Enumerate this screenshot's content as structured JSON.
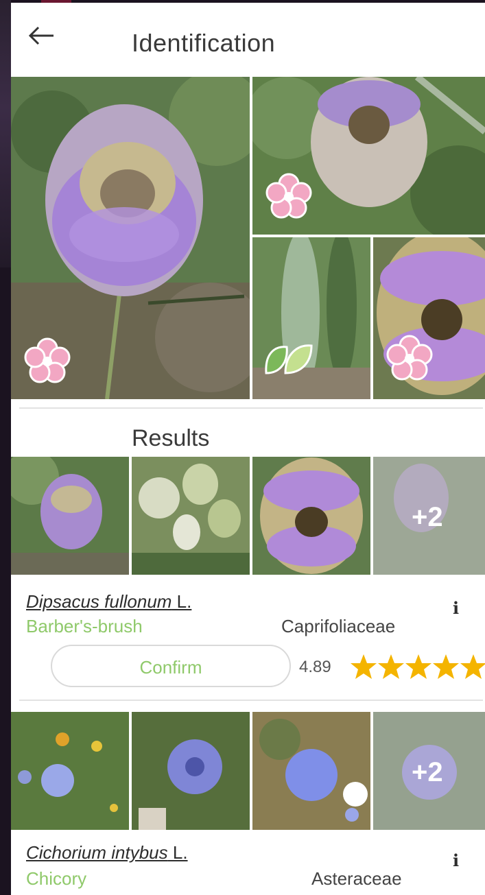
{
  "header": {
    "title": "Identification"
  },
  "identification": {
    "images": [
      {
        "label": "flower-photo-1",
        "organ": "flower"
      },
      {
        "label": "flower-photo-2",
        "organ": "flower"
      },
      {
        "label": "leaf-photo",
        "organ": "leaf"
      },
      {
        "label": "flower-photo-3",
        "organ": "flower"
      }
    ]
  },
  "results": {
    "title": "Results",
    "items": [
      {
        "species": "Dipsacus fullonum",
        "author": " L.",
        "common_name": "Barber's-brush",
        "family": "Caprifoliaceae",
        "extra_images": "+2",
        "confirm_label": "Confirm",
        "score": "4.89",
        "stars": 5
      },
      {
        "species": "Cichorium intybus",
        "author": " L.",
        "common_name": "Chicory",
        "family": "Asteraceae",
        "extra_images": "+2"
      }
    ]
  },
  "colors": {
    "accent_green": "#8fc96a",
    "star": "#f4b400",
    "flower_badge": "#f2a7c3"
  }
}
